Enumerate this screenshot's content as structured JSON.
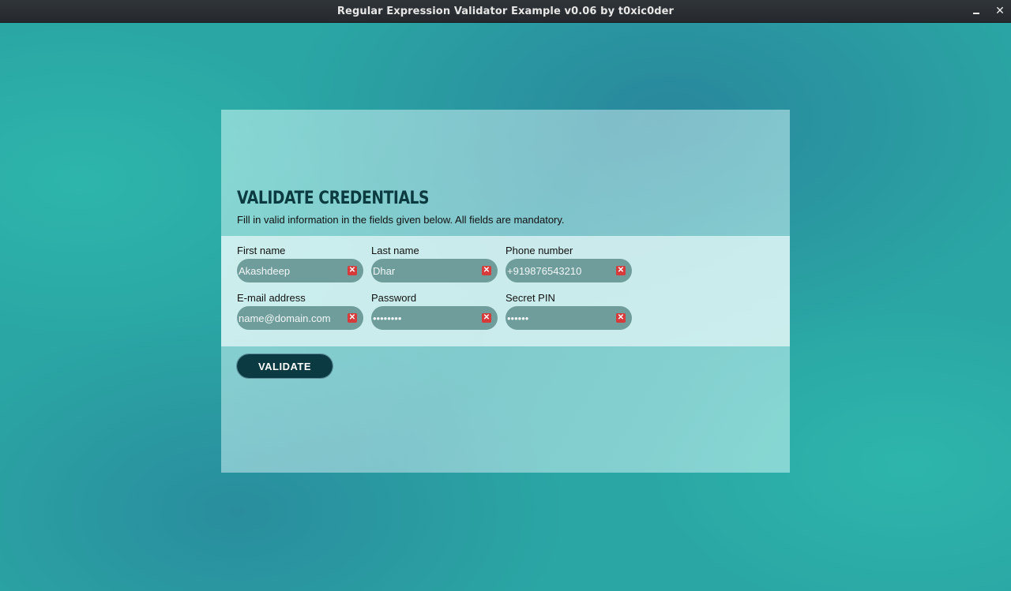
{
  "window": {
    "title": "Regular Expression Validator Example v0.06 by t0xic0der",
    "minimize_glyph": "",
    "close_glyph": "✕"
  },
  "form": {
    "heading": "VALIDATE CREDENTIALS",
    "subtitle": "Fill in valid information in the fields given below. All fields are mandatory.",
    "fields": {
      "first_name": {
        "label": "First name",
        "value": "Akashdeep",
        "status_icon": "error-icon"
      },
      "last_name": {
        "label": "Last name",
        "value": "Dhar",
        "status_icon": "error-icon"
      },
      "phone": {
        "label": "Phone number",
        "value": "+919876543210",
        "status_icon": "error-icon"
      },
      "email": {
        "label": "E-mail address",
        "value": "name@domain.com",
        "status_icon": "error-icon"
      },
      "password": {
        "label": "Password",
        "value": "••••••••",
        "status_icon": "error-icon"
      },
      "pin": {
        "label": "Secret PIN",
        "value": "••••••",
        "status_icon": "error-icon"
      }
    },
    "validate_label": "VALIDATE"
  },
  "colors": {
    "accent": "#0b3a42",
    "field_bg": "#6f9d9c",
    "error": "#d63a3a",
    "background": "#2aa6a4"
  }
}
